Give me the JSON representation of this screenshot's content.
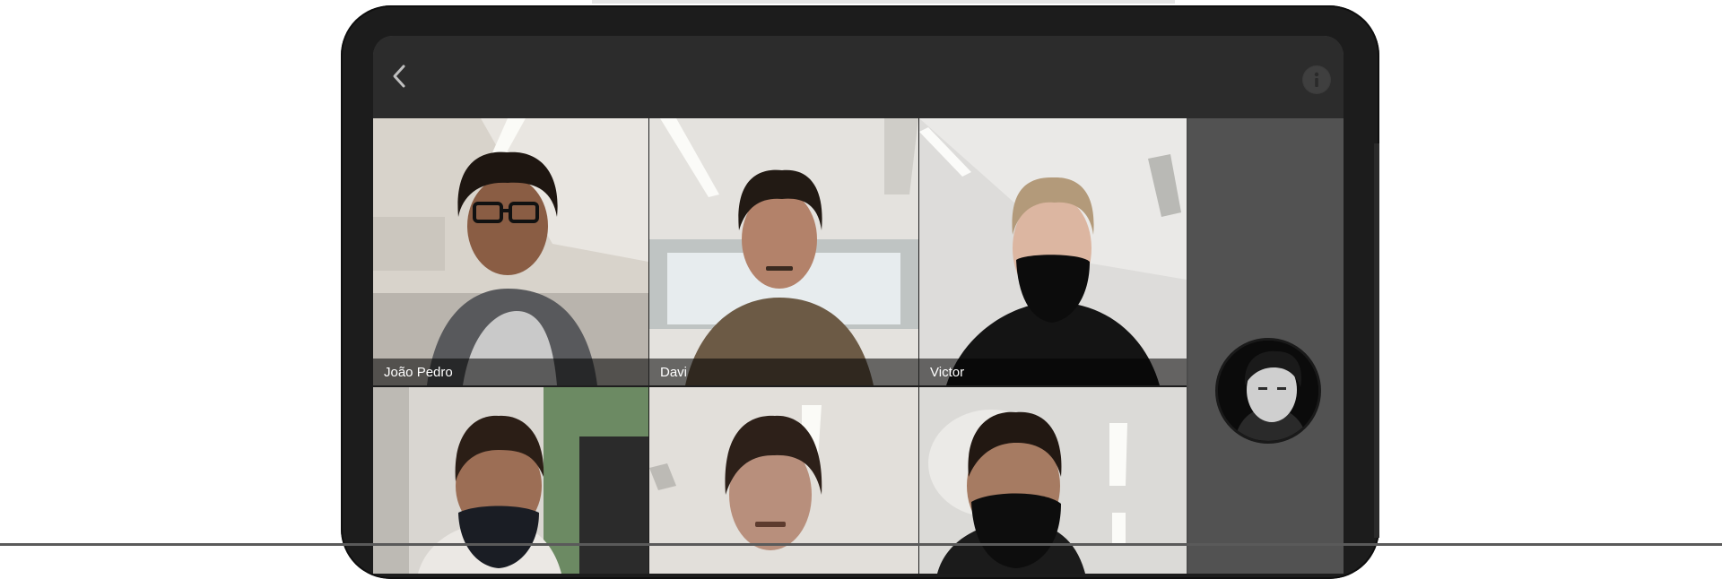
{
  "app": {
    "back_icon": "chevron-left-icon",
    "info_icon": "info-icon"
  },
  "participants": [
    {
      "name": "João Pedro"
    },
    {
      "name": "Davi"
    },
    {
      "name": "Victor"
    },
    {
      "name": ""
    },
    {
      "name": ""
    },
    {
      "name": ""
    }
  ],
  "colors": {
    "topbar": "#2c2c2c",
    "side_panel": "#525252",
    "bezel": "#1c1c1c"
  }
}
